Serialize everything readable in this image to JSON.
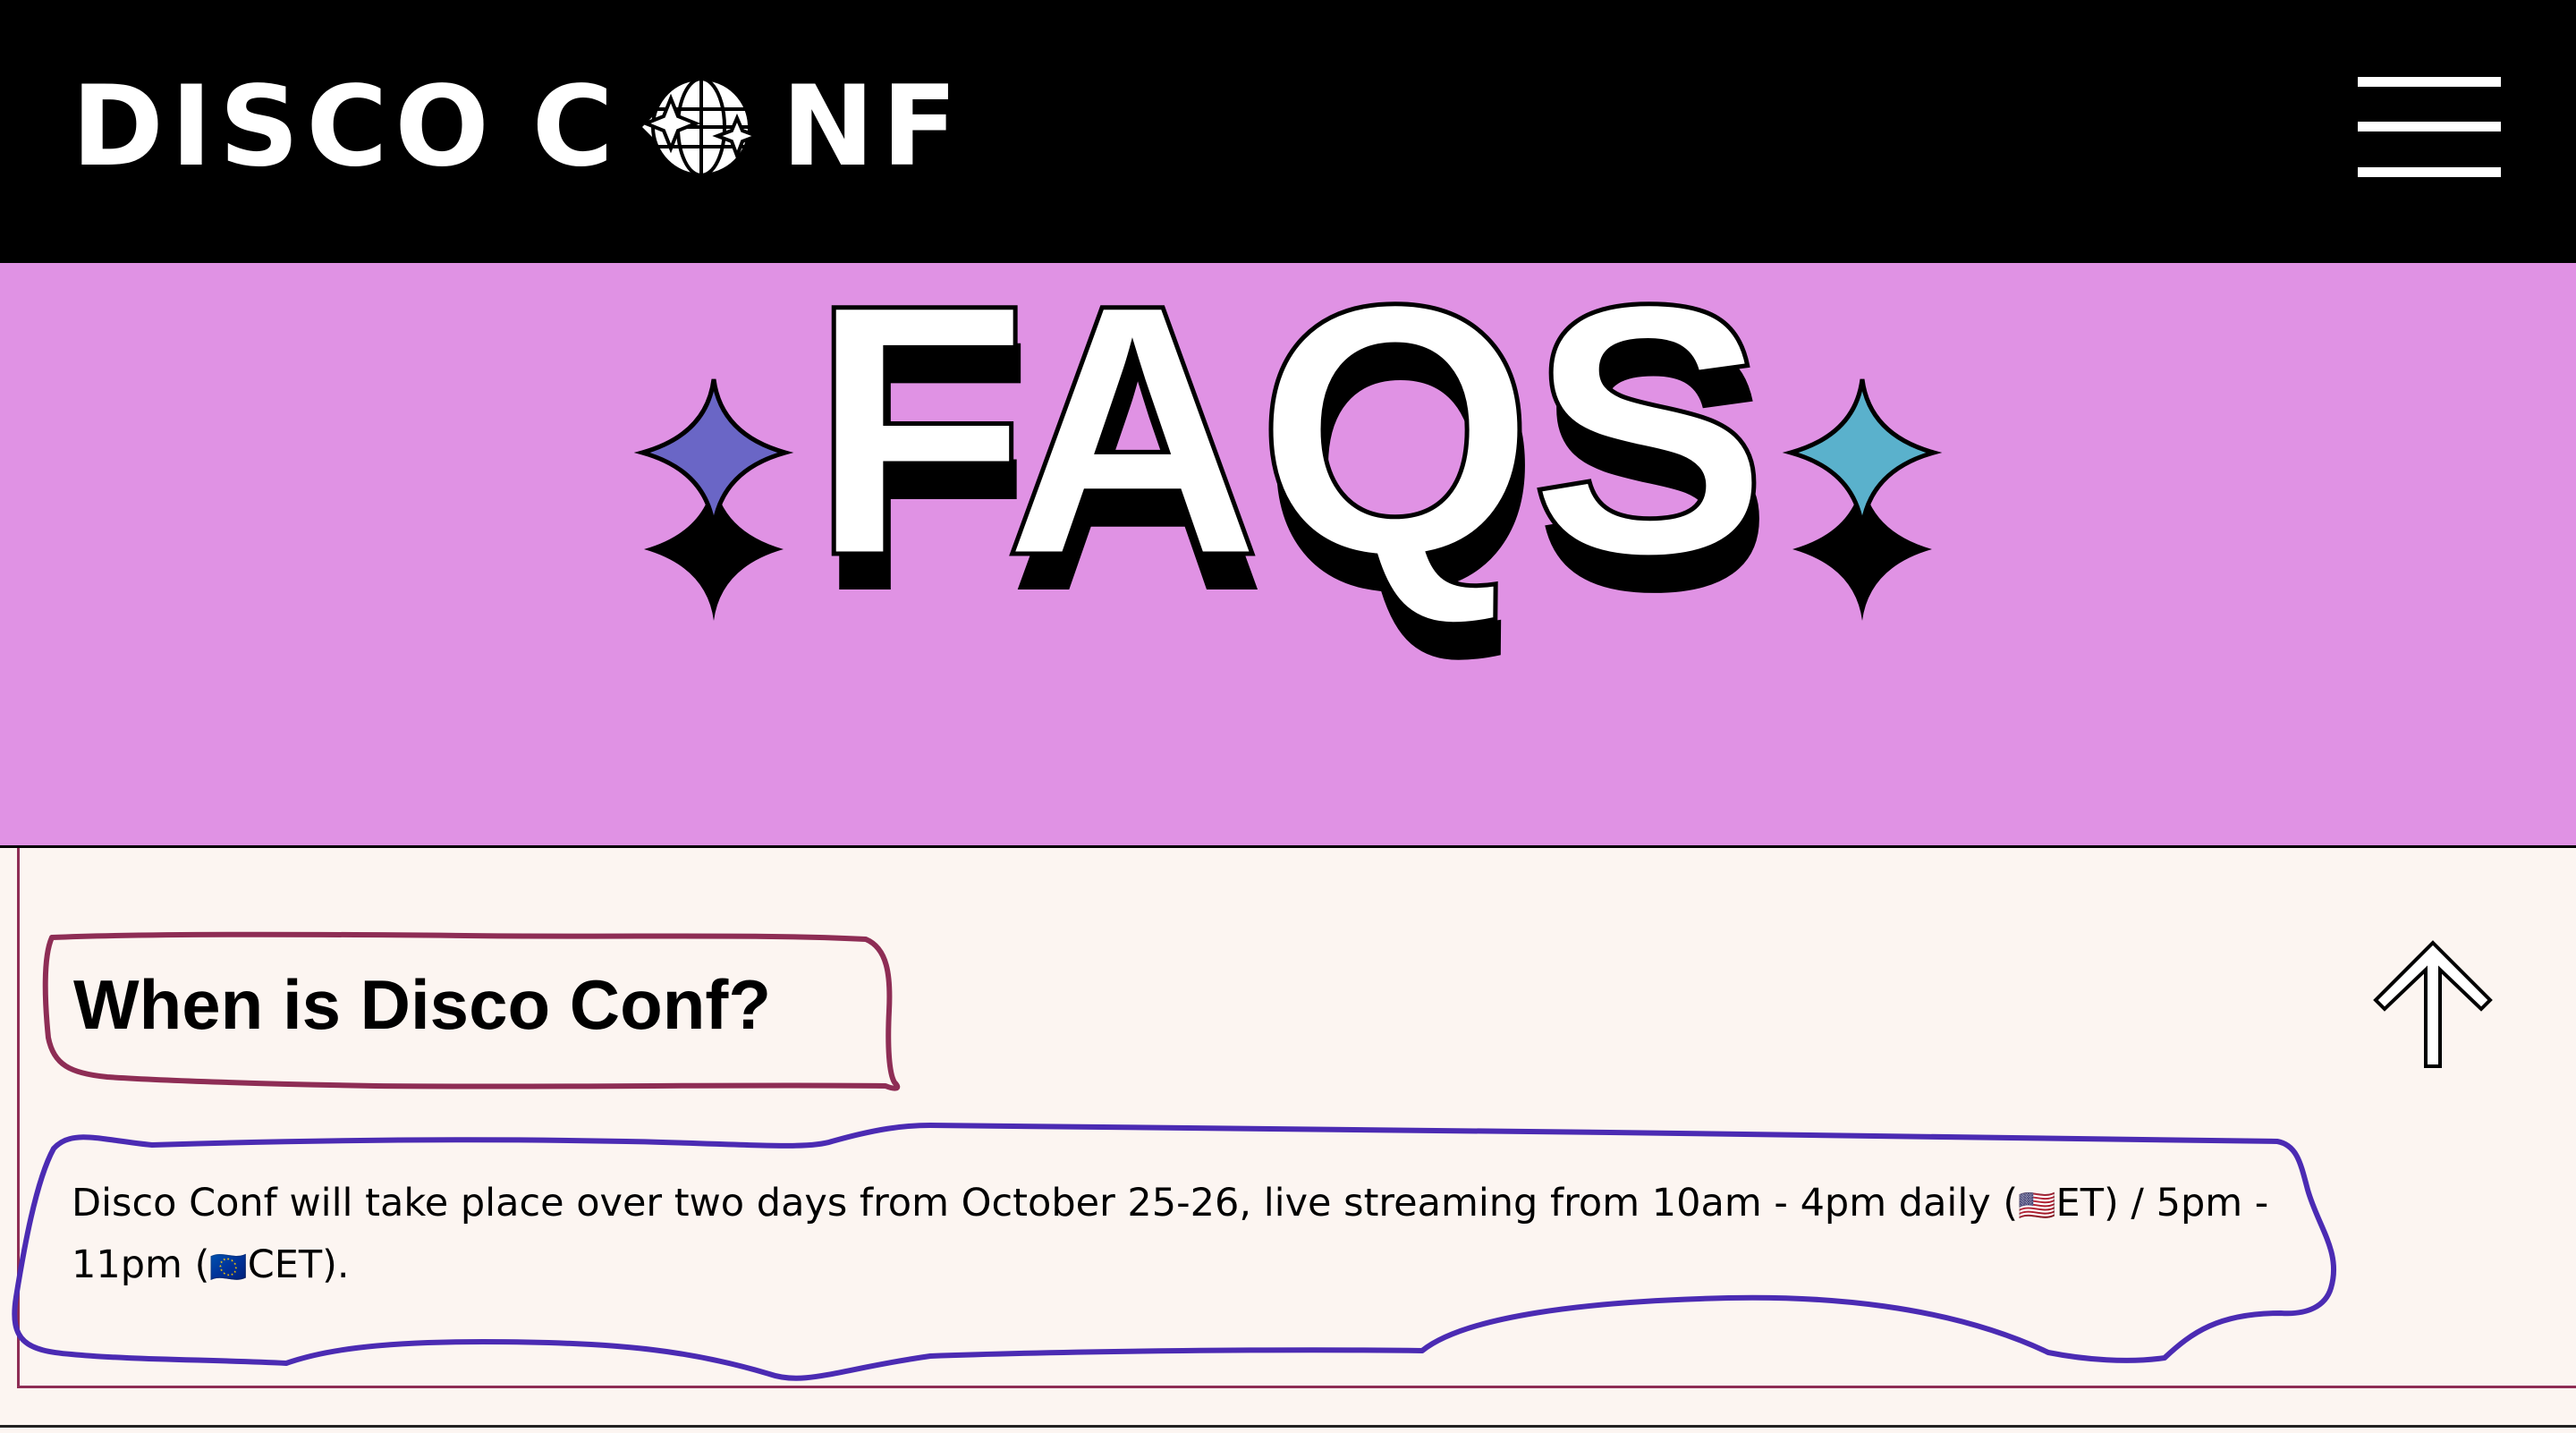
{
  "header": {
    "logo_left": "DISCO",
    "logo_right": "NF",
    "logo_alt": "Disco Conf",
    "menu_icon": "hamburger-menu-icon"
  },
  "hero": {
    "title": "FAQS",
    "left_sparkle_color": "#6a66c6",
    "right_sparkle_color": "#5ab1cc",
    "background": "#e092e4"
  },
  "faq": {
    "question": "When is Disco Conf?",
    "answer_part1": "Disco Conf will take place over two days from October 25-26, live streaming from 10am - 4pm daily (",
    "flag_us": "🇺🇸",
    "answer_part2": "ET) / 5pm - 11pm (",
    "flag_eu": "🇪🇺",
    "answer_part3": "CET).",
    "toggle_icon": "arrow-up-icon"
  },
  "colors": {
    "annotation_question": "#8e2d55",
    "annotation_answer": "#4b2bb3",
    "faq_background": "#fcf5f1"
  }
}
